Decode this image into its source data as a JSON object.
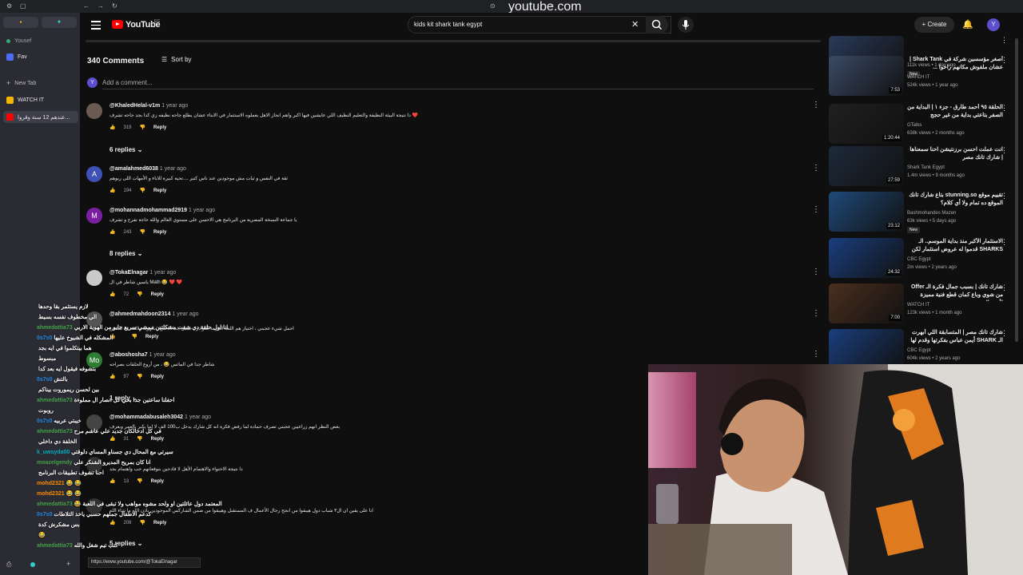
{
  "browser": {
    "url": "youtube.com",
    "sidebar": {
      "profile": "Yousef",
      "items": [
        {
          "label": "Fav",
          "color": "#4a6cf7"
        },
        {
          "label": "New Tab",
          "color": "#777777"
        },
        {
          "label": "WATCH IT",
          "color": "#f5b400"
        },
        {
          "label": "عندهم 12 سنة وقروا...",
          "color": "#ff0000"
        }
      ]
    }
  },
  "youtube": {
    "logo": "YouTube",
    "logo_country": "EG",
    "search_value": "kids kit shark tank egypt",
    "create_label": "Create",
    "avatar_letter": "Y"
  },
  "comments": {
    "count_label": "340 Comments",
    "sort_label": "Sort by",
    "add_placeholder": "Add a comment...",
    "add_avatar": "Y",
    "items": [
      {
        "author": "@KhaledHelal-v1m",
        "time": "1 year ago",
        "text": "دا نتيجة البيئة النظيفة والتعليم النظيف اللي عايشين فيها اكبر واهم انجاز الاهل يعملوه الاستثمار في الابناء عشان يطلع جاحه نظيفه زي كدا بجد جاحه تشرف ❤️",
        "likes": "319",
        "reply": "Reply",
        "avatar_letter": "",
        "avatar_color": "#6b5a52"
      },
      {
        "author": "@amalahmed6038",
        "time": "1 year ago",
        "text": "ثقة في النفس و ثبات مش موجودين عند ناس كتير ....تحية كبيرة للاباء و الأمهات اللى ربوهم",
        "likes": "194",
        "reply": "Reply",
        "avatar_letter": "A",
        "avatar_color": "#3f51b5"
      },
      {
        "author": "@mohannadmohammad2919",
        "time": "1 year ago",
        "text": "يا جماعة النسخة المصرية من البرنامج هي الاحسن على مستوي العالم والله حاجة تفرح و تشرف",
        "likes": "243",
        "reply": "Reply",
        "avatar_letter": "M",
        "avatar_color": "#7b1fa2"
      },
      {
        "author": "@TokaElnagar",
        "time": "1 year ago",
        "text": "ياسين شاطر في ال Math 😂 ❤️ ❤️",
        "likes": "72",
        "reply": "Reply",
        "avatar_letter": "",
        "avatar_color": "#c9c9c9"
      },
      {
        "author": "@ahmedmahdoon2314",
        "time": "1 year ago",
        "text": "اجمل شيء عجبني ، اختيار هم اللغة العربية للنوادر ، جميل جدا الاعتزاز بالهوية والثقة ف النفس",
        "likes": "",
        "reply": "Reply",
        "avatar_letter": "",
        "avatar_color": "#555555"
      },
      {
        "author": "@aboshosha7",
        "time": "1 year ago",
        "text": "شاطر جدا في الماتس 😂 ، من أروع الحلقات بصراحه",
        "likes": "97",
        "reply": "Reply",
        "avatar_letter": "Mo",
        "avatar_color": "#2e7d32"
      },
      {
        "author": "@mohammadabusaleh3042",
        "time": "1 year ago",
        "text": "بغض النظر انهم زراعيين عجبني تصرف حمادة لما رفض فكرة انه كل شارك يدخل ب100 الف لا لما يكبر بالعمر ويعرف",
        "likes": "31",
        "reply": "Reply",
        "avatar_letter": "",
        "avatar_color": "#444444"
      },
      {
        "author": "",
        "time": "",
        "text": "دا نتيجة الاحتواء والاهتمام الأهل لا قادحين بتوقعاتهم حب واهتمام بجد",
        "likes": "13",
        "reply": "Reply",
        "avatar_letter": "",
        "avatar_color": "#333333"
      },
      {
        "author": "",
        "time": "",
        "text": "انا على يقين ان ال٣ شباب دول هيبقوا من انجح رجال الأعمال ف المستقبل وهيبقوا من ضمن الشاركس الموجودين ياذن الله ما شاء الله",
        "likes": "208",
        "reply": "Reply",
        "avatar_letter": "",
        "avatar_color": "#333333"
      }
    ],
    "reply_toggles": [
      "6 replies",
      "8 replies",
      "1 reply",
      "5 replies"
    ]
  },
  "recommendations": [
    {
      "title": "",
      "channel": "",
      "meta": "111k views • 1 day ago",
      "duration": "22:21",
      "badge": "New",
      "thumb": "#2a3a5a"
    },
    {
      "title": "أصغر مؤسسين شركة في Shark Tank | عشان ملفوش مكانهم راحوا ...",
      "channel": "WATCH IT",
      "meta": "524k views • 1 year ago",
      "duration": "7:53",
      "badge": "",
      "thumb": "#3b4a66"
    },
    {
      "title": "الحلقة ٩٥ أحمد طارق - جزء ١ | البداية من الصفر بتاعتي بداية من غير حجج",
      "channel": "GTalks",
      "meta": "638k views • 2 months ago",
      "duration": "1:20:44",
      "badge": "",
      "thumb": "#202020"
    },
    {
      "title": "انت عملت احسن برزنتيشن احنا سمعناها | شارك تانك مصر",
      "channel": "Shark Tank Egypt",
      "meta": "1.4m views • 9 months ago",
      "duration": "27:59",
      "badge": "",
      "thumb": "#1d2a3a"
    },
    {
      "title": "تقييم موقع stunning.so بتاع شارك تانك الموقع ده تمام ولا أي كلام؟",
      "channel": "Bashmohandes Mazen",
      "meta": "63k views • 5 days ago",
      "duration": "23:12",
      "badge": "New",
      "thumb": "#1f4a7a"
    },
    {
      "title": "الاستثمار الأكبر منذ بداية الموسم.. الـ SHARKS قدموا له عروض استثمار لكن ...",
      "channel": "CBC Egypt",
      "meta": "2m views • 2 years ago",
      "duration": "24:32",
      "badge": "",
      "thumb": "#1a3e7e"
    },
    {
      "title": "شارك تانك | بسبب جمال فكرة الـ Offer من شوي وباع كمان قطع فنية مميزة لأيمن التي",
      "channel": "WATCH IT",
      "meta": "123k views • 1 month ago",
      "duration": "7:00",
      "badge": "",
      "thumb": "#4a2f1f"
    },
    {
      "title": "شارك تانك مصر | المتسابقة اللي أبهرت الـ SHARK أيمن عباس بفكرتها وقدم لها",
      "channel": "CBC Egypt",
      "meta": "604k views • 2 years ago",
      "duration": "",
      "badge": "",
      "thumb": "#1a3e7e"
    }
  ],
  "chat": [
    {
      "user": "",
      "msg": "لازم يستثمر بقا وحدها",
      "color": "#e53935"
    },
    {
      "user": "",
      "msg": "الي مخطوف نفسه بسيط",
      "color": "#e53935"
    },
    {
      "user": "ahmedattia73",
      "msg": "انا اول حلقة دي شفت مشكلتين ممشي سريع جابو من الهوية الاربي",
      "color": "#43a047"
    },
    {
      "user": "0s7s0",
      "msg": "المشكله في الشيوخ عليها",
      "color": "#1e88e5"
    },
    {
      "user": "",
      "msg": "هما بيتكلموا في ايه بجد",
      "color": "#e53935"
    },
    {
      "user": "",
      "msg": "مبسوط",
      "color": "#e53935"
    },
    {
      "user": "",
      "msg": "بتشوفه فيقول ايه بعد كدا",
      "color": "#e53935"
    },
    {
      "user": "0s7s0",
      "msg": "بالتش",
      "color": "#1e88e5"
    },
    {
      "user": "",
      "msg": "بين لحسن ريموروت بيناكم",
      "color": "#e53935"
    },
    {
      "user": "ahmedattia73",
      "msg": "احفلنا ساعتين جدا بحي كل انصار ال مملوءة",
      "color": "#43a047"
    },
    {
      "user": "",
      "msg": "روبوت",
      "color": "#e53935"
    },
    {
      "user": "0s7s0",
      "msg": "خيبتي عربيه",
      "color": "#1e88e5"
    },
    {
      "user": "ahmedattia73",
      "msg": "في كل ادخالكان جديد علي عاشم مرح",
      "color": "#43a047"
    },
    {
      "user": "",
      "msg": "الخلفة دي داخلي",
      "color": "#e53935"
    },
    {
      "user": "k_uwsyda00",
      "msg": "سيرتي مع المحال دي جسناو المساي دلوقتي",
      "color": "#00acc1"
    },
    {
      "user": "moazelgendy",
      "msg": "انا كان بمريح المديرو الشنكر علي",
      "color": "#43a047"
    },
    {
      "user": "",
      "msg": "احنا تشوف تطبيقات البرنامج",
      "color": "#e53935"
    },
    {
      "user": "mohd2321",
      "msg": "😂 😂",
      "color": "#fb8c00"
    },
    {
      "user": "mohd2321",
      "msg": "😂 😂",
      "color": "#fb8c00"
    },
    {
      "user": "ahmedattia73",
      "msg": "😂 المعتمد دول عائلتين او ولحد مشوه مواهب ولا تبقى في اللعبة",
      "color": "#43a047"
    },
    {
      "user": "0s7s0",
      "msg": "كدعم الاطفال جملهم حسبي ياخذ التلاطات",
      "color": "#1e88e5"
    },
    {
      "user": "",
      "msg": "بس مشكرش كدة",
      "color": "#e53935"
    },
    {
      "user": "",
      "msg": "😂",
      "color": "#e53935"
    },
    {
      "user": "ahmedattia73",
      "msg": "كتب تيم شغل والله",
      "color": "#43a047"
    }
  ],
  "status_url": "https://www.youtube.com/@TokaElnagar"
}
